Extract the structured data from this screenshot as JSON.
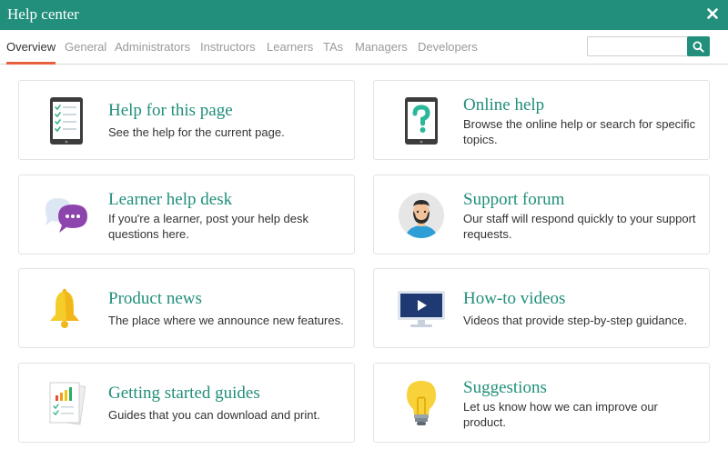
{
  "window": {
    "title": "Help center"
  },
  "tabs": [
    {
      "label": "Overview",
      "active": true
    },
    {
      "label": "General"
    },
    {
      "label": "Administrators"
    },
    {
      "label": "Instructors"
    },
    {
      "label": "Learners"
    },
    {
      "label": "TAs"
    },
    {
      "label": "Managers"
    },
    {
      "label": "Developers"
    }
  ],
  "search": {
    "value": "",
    "placeholder": ""
  },
  "cards": [
    {
      "title": "Help for this page",
      "description": "See the help for the current page.",
      "icon": "tablet-checklist-icon"
    },
    {
      "title": "Online help",
      "description": "Browse the online help or search for specific topics.",
      "icon": "tablet-question-icon"
    },
    {
      "title": "Learner help desk",
      "description": "If you're a learner, post your help desk questions here.",
      "icon": "chat-bubbles-icon"
    },
    {
      "title": "Support forum",
      "description": "Our staff will respond quickly to your support requests.",
      "icon": "support-agent-avatar-icon"
    },
    {
      "title": "Product news",
      "description": "The place where we announce new features.",
      "icon": "bell-icon"
    },
    {
      "title": "How-to videos",
      "description": "Videos that provide step-by-step guidance.",
      "icon": "video-monitor-icon"
    },
    {
      "title": "Getting started guides",
      "description": "Guides that you can download and print.",
      "icon": "documents-chart-icon"
    },
    {
      "title": "Suggestions",
      "description": "Let us know how we can improve our product.",
      "icon": "lightbulb-icon"
    }
  ],
  "colors": {
    "brand": "#218f7b",
    "tab_underline": "#e8603c"
  }
}
